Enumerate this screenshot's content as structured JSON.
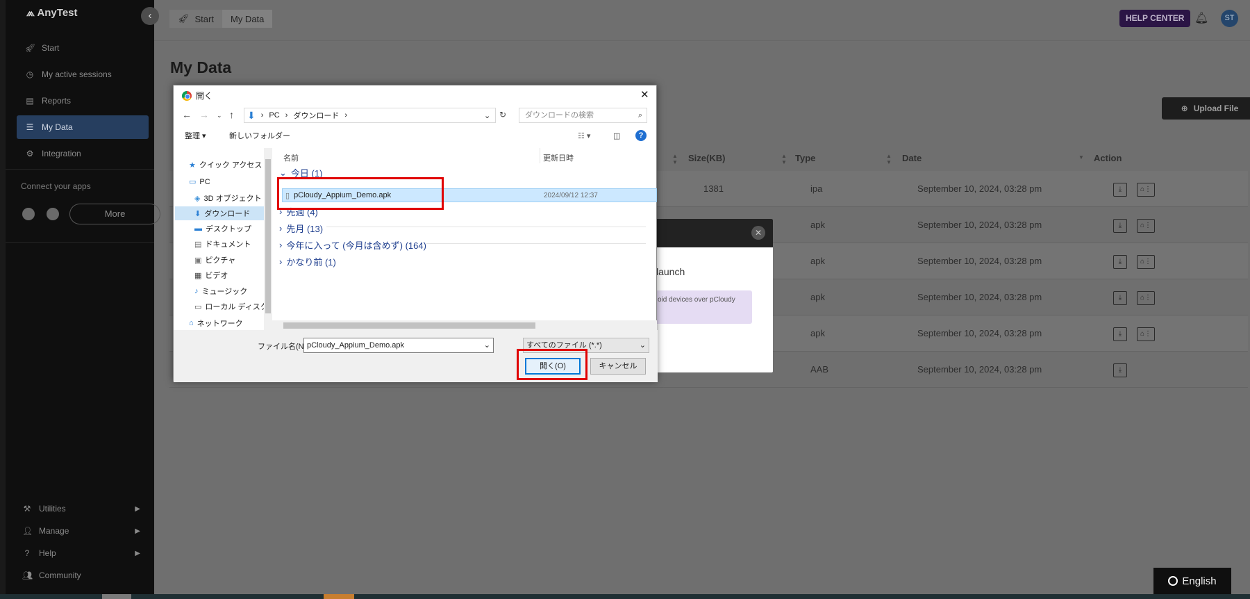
{
  "app": {
    "name": "AnyTest"
  },
  "sidebar": {
    "items": [
      {
        "label": "Start",
        "icon": "rocket-icon"
      },
      {
        "label": "My active sessions",
        "icon": "clock-icon"
      },
      {
        "label": "Reports",
        "icon": "report-icon"
      },
      {
        "label": "My Data",
        "icon": "database-icon",
        "active": true
      },
      {
        "label": "Integration",
        "icon": "integration-icon"
      }
    ],
    "connect_label": "Connect your apps",
    "more_label": "More",
    "bottom": [
      {
        "label": "Utilities",
        "icon": "tools-icon"
      },
      {
        "label": "Manage",
        "icon": "user-icon"
      },
      {
        "label": "Help",
        "icon": "help-icon"
      },
      {
        "label": "Community",
        "icon": "community-icon"
      }
    ]
  },
  "header": {
    "breadcrumb": [
      "Start",
      "My Data"
    ],
    "help_center": "HELP CENTER",
    "avatar": "ST"
  },
  "page": {
    "title": "My Data",
    "upload_label": "Upload File",
    "columns": [
      "Size(KB)",
      "Type",
      "Date",
      "Action"
    ],
    "rows": [
      {
        "size": "1381",
        "type": "ipa",
        "date": "September 10, 2024, 03:28 pm"
      },
      {
        "size": "",
        "type": "apk",
        "date": "September 10, 2024, 03:28 pm"
      },
      {
        "size": "",
        "type": "apk",
        "date": "September 10, 2024, 03:28 pm"
      },
      {
        "size": "",
        "type": "apk",
        "date": "September 10, 2024, 03:28 pm"
      },
      {
        "size": "",
        "type": "apk",
        "date": "September 10, 2024, 03:28 pm"
      },
      {
        "size": "",
        "type": "AAB",
        "date": "September 10, 2024, 03:28 pm"
      }
    ]
  },
  "bg_modal": {
    "launch": "launch",
    "note": "oid devices over pCloudy"
  },
  "dialog": {
    "title": "開く",
    "address": [
      "PC",
      "ダウンロード"
    ],
    "search_placeholder": "ダウンロードの検索",
    "organize": "整理",
    "new_folder": "新しいフォルダー",
    "tree": [
      {
        "label": "クイック アクセス",
        "icon": "star-icon"
      },
      {
        "label": "PC",
        "icon": "pc-icon"
      },
      {
        "label": "3D オブジェクト",
        "icon": "cube-icon"
      },
      {
        "label": "ダウンロード",
        "icon": "download-icon",
        "selected": true
      },
      {
        "label": "デスクトップ",
        "icon": "desktop-icon"
      },
      {
        "label": "ドキュメント",
        "icon": "document-icon"
      },
      {
        "label": "ピクチャ",
        "icon": "picture-icon"
      },
      {
        "label": "ビデオ",
        "icon": "video-icon"
      },
      {
        "label": "ミュージック",
        "icon": "music-icon"
      },
      {
        "label": "ローカル ディスク (C",
        "icon": "disk-icon"
      },
      {
        "label": "ネットワーク",
        "icon": "network-icon"
      }
    ],
    "col_name": "名前",
    "col_date": "更新日時",
    "groups": [
      "今日 (1)",
      "先週 (4)",
      "先月 (13)",
      "今年に入って (今月は含めず) (164)",
      "かなり前 (1)"
    ],
    "file": {
      "name": "pCloudy_Appium_Demo.apk",
      "date": "2024/09/12 12:37"
    },
    "filename_label": "ファイル名(N):",
    "filename_value": "pCloudy_Appium_Demo.apk",
    "filetype": "すべてのファイル (*.*)",
    "open": "開く(O)",
    "cancel": "キャンセル"
  },
  "language": "English",
  "colors": {
    "accent": "#0078d7",
    "highlight": "#e00000",
    "help_center": "#2b1545"
  }
}
